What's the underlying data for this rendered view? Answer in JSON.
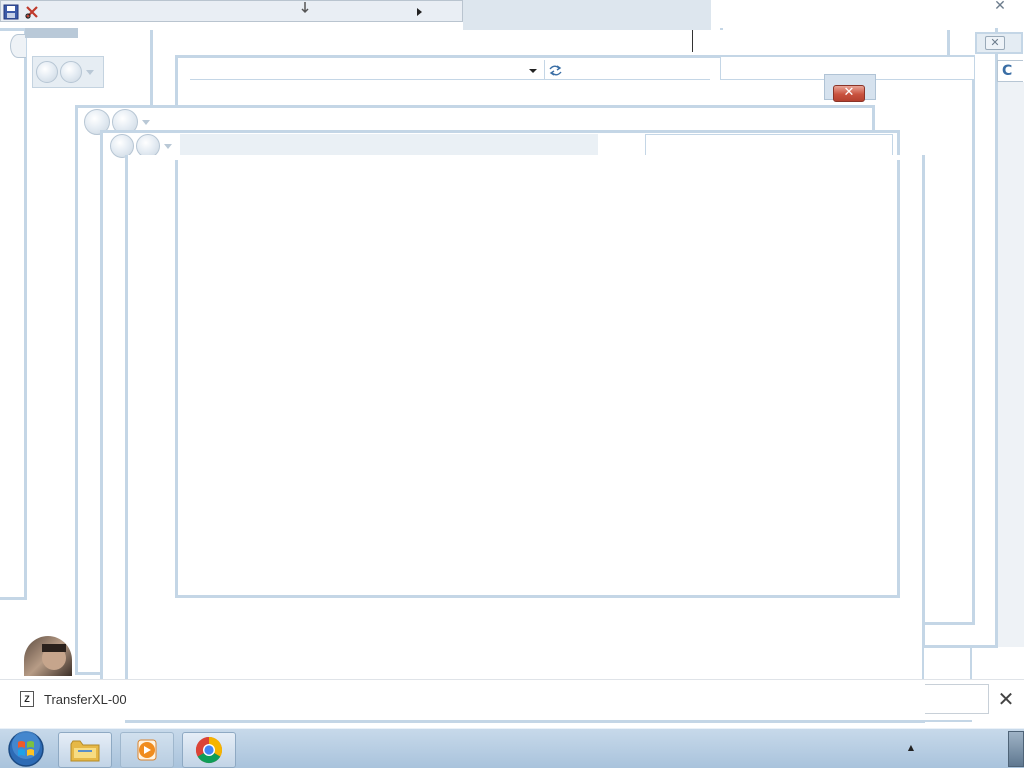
{
  "download_bar": {
    "file_name": "TransferXL-00",
    "file_icon": "Z",
    "close_glyph": "✕"
  },
  "dialog": {
    "close_glyph": "✕"
  },
  "corner": {
    "close_glyph": "✕",
    "sub_close_glyph": "✕",
    "refresh_glyph": "C"
  },
  "taskbar": {
    "items": [
      {
        "name": "Windows Explorer"
      },
      {
        "name": "Windows Media Player"
      },
      {
        "name": "Google Chrome"
      }
    ],
    "tray_arrow": "▲"
  },
  "colors": {
    "window_frame": "#c4d6e6",
    "taskbar": "#b7cee4",
    "close_button": "#c9523f"
  }
}
